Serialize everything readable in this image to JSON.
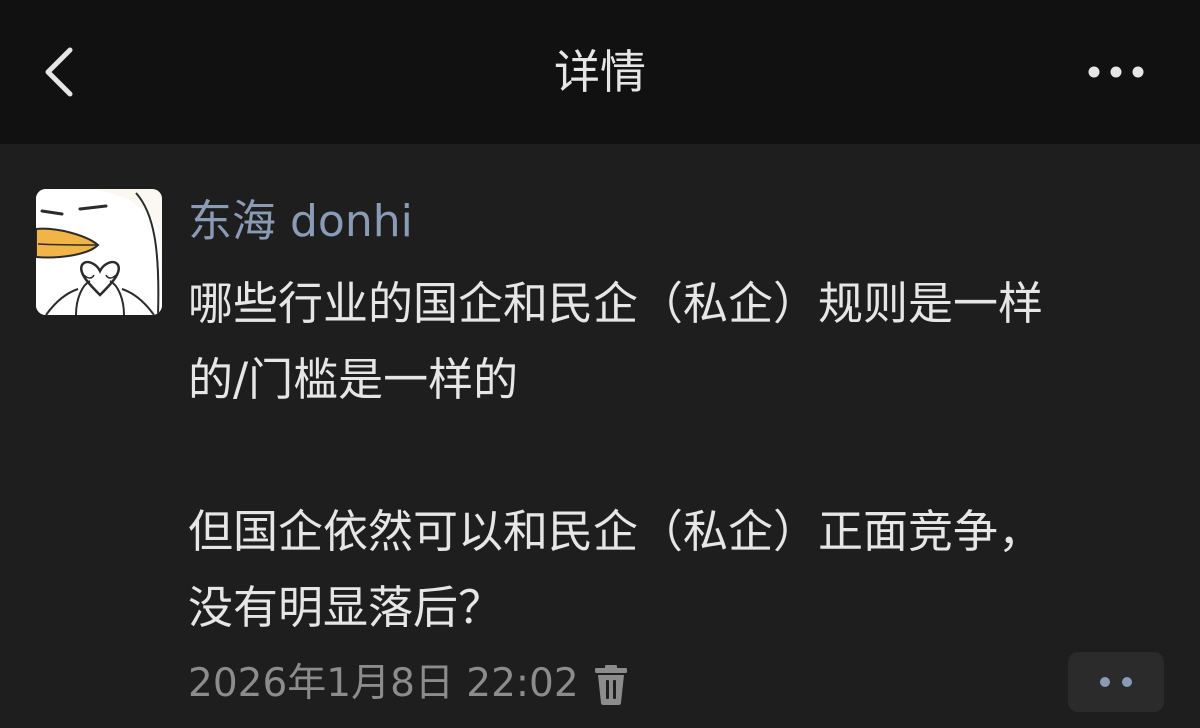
{
  "header": {
    "back_icon": "chevron-left-icon",
    "title": "详情",
    "more_icon": "more-horizontal-icon"
  },
  "post": {
    "avatar_icon": "duck-heart-avatar",
    "author": "东海 donhi",
    "text": "哪些行业的国企和民企（私企）规则是一样\n的/门槛是一样的\n\n但国企依然可以和民企（私企）正面竞争，\n没有明显落后？",
    "timestamp": "2026年1月8日 22:02",
    "delete_icon": "trash-icon",
    "action_icon": "more-dots-icon"
  },
  "colors": {
    "navbar_bg": "#111111",
    "page_bg": "#1e1e1e",
    "author_color": "#8a9bb6",
    "text_color": "#e6e6e6",
    "meta_color": "#8c8c8c"
  }
}
